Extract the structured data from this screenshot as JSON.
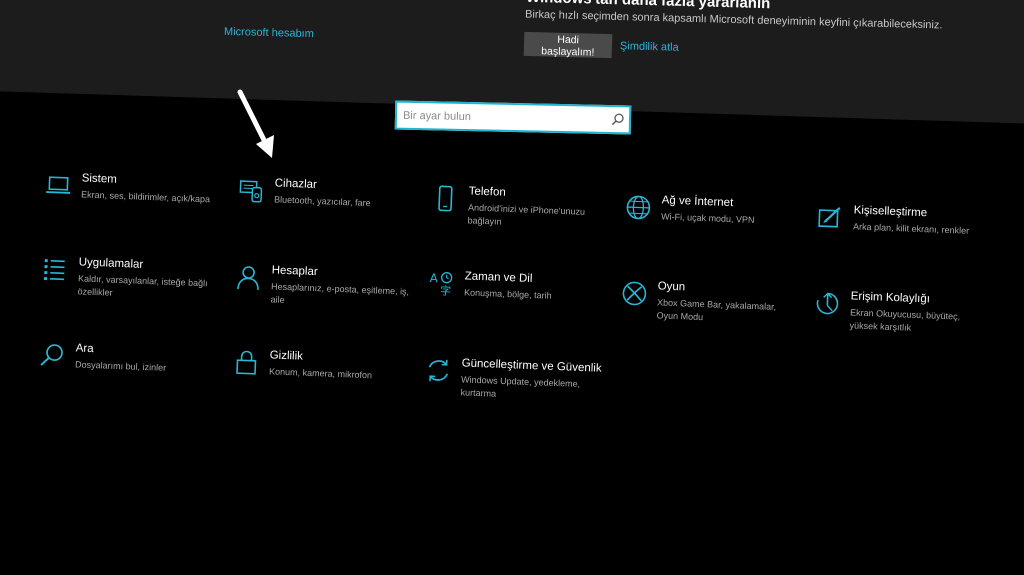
{
  "banner": {
    "account_link": "Microsoft hesabım",
    "title": "Windows'tan daha fazla yararlanın",
    "description": "Birkaç hızlı seçimden sonra kapsamlı Microsoft deneyiminin keyfini çıkarabileceksiniz.",
    "start_button": "Hadi başlayalım!",
    "skip_link": "Şimdilik atla"
  },
  "search": {
    "placeholder": "Bir ayar bulun"
  },
  "colors": {
    "accent": "#29b6d4",
    "background": "#000000",
    "banner": "#1c1c1c"
  },
  "tiles": [
    {
      "title": "Sistem",
      "desc": "Ekran, ses, bildirimler, açık/kapa",
      "icon": "laptop-icon"
    },
    {
      "title": "Cihazlar",
      "desc": "Bluetooth, yazıcılar, fare",
      "icon": "devices-icon"
    },
    {
      "title": "Telefon",
      "desc": "Android'inizi ve iPhone'unuzu bağlayın",
      "icon": "phone-icon"
    },
    {
      "title": "Ağ ve İnternet",
      "desc": "Wi-Fi, uçak modu, VPN",
      "icon": "globe-icon"
    },
    {
      "title": "Kişiselleştirme",
      "desc": "Arka plan, kilit ekranı, renkler",
      "icon": "personalization-icon"
    },
    {
      "title": "Uygulamalar",
      "desc": "Kaldır, varsayılanlar, isteğe bağlı özellikler",
      "icon": "apps-list-icon"
    },
    {
      "title": "Hesaplar",
      "desc": "Hesaplarınız, e-posta, eşitleme, iş, aile",
      "icon": "person-icon"
    },
    {
      "title": "Zaman ve Dil",
      "desc": "Konuşma, bölge, tarih",
      "icon": "time-language-icon"
    },
    {
      "title": "Oyun",
      "desc": "Xbox Game Bar, yakalamalar, Oyun Modu",
      "icon": "xbox-icon"
    },
    {
      "title": "Erişim Kolaylığı",
      "desc": "Ekran Okuyucusu, büyüteç, yüksek karşıtlık",
      "icon": "ease-of-access-icon"
    },
    {
      "title": "Ara",
      "desc": "Dosyalarımı bul, izinler",
      "icon": "search-icon"
    },
    {
      "title": "Gizlilik",
      "desc": "Konum, kamera, mikrofon",
      "icon": "lock-icon"
    },
    {
      "title": "Güncelleştirme ve Güvenlik",
      "desc": "Windows Update, yedekleme, kurtarma",
      "icon": "update-icon"
    }
  ]
}
